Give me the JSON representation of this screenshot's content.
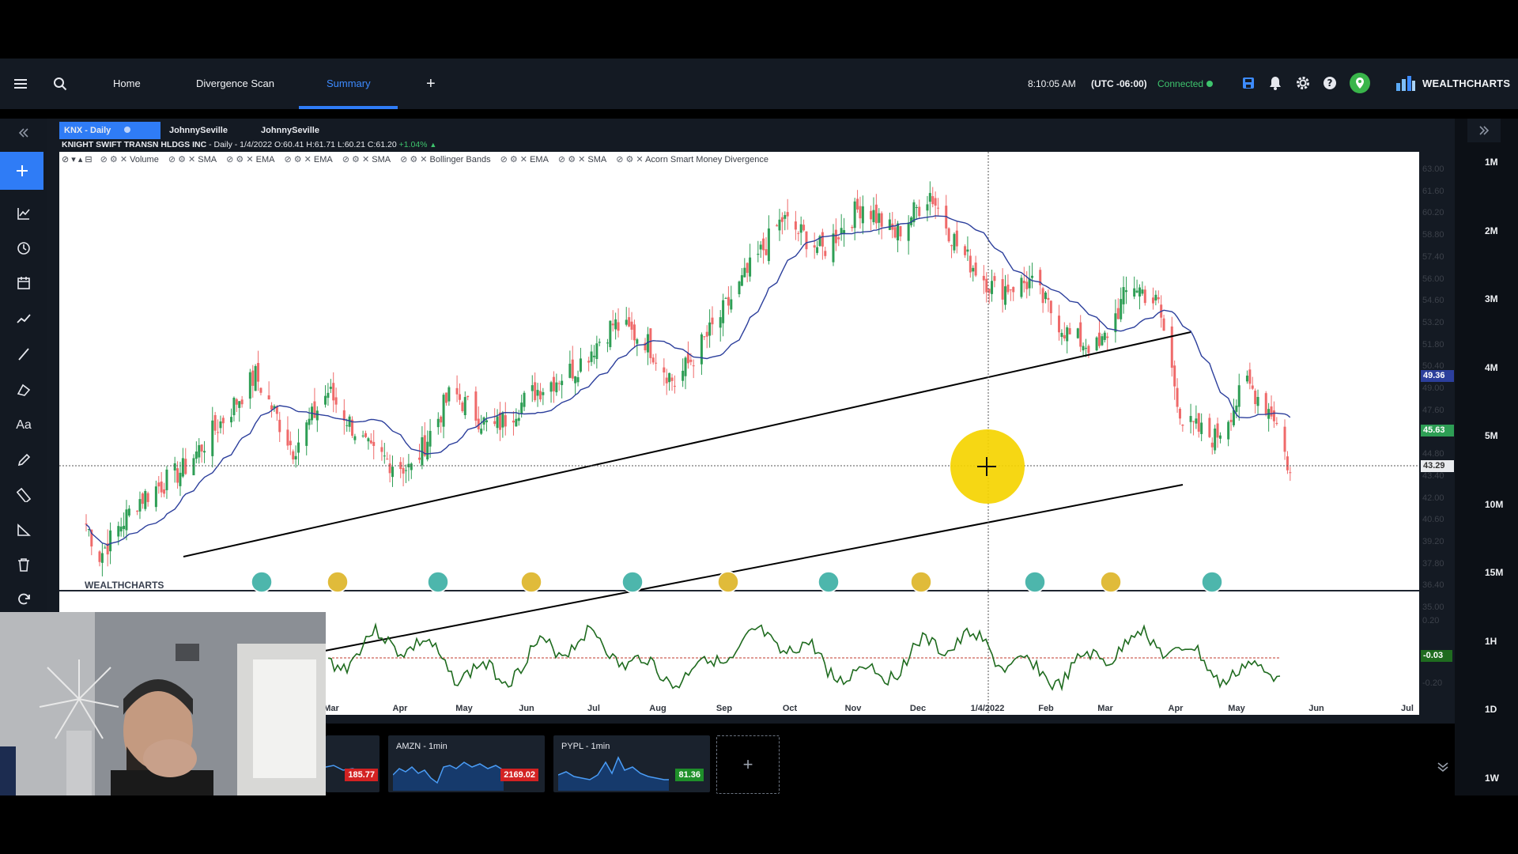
{
  "header": {
    "nav_tabs": [
      {
        "label": "Home"
      },
      {
        "label": "Divergence Scan"
      },
      {
        "label": "Summary",
        "active": true
      }
    ],
    "add_tab": "+",
    "time": "8:10:05 AM",
    "timezone": "(UTC -06:00)",
    "status": "Connected",
    "brand": "WEALTHCHARTS"
  },
  "chart": {
    "tabs": [
      {
        "label": "KNX - Daily",
        "active": true
      },
      {
        "label": "JohnnySeville"
      },
      {
        "label": "JohnnySeville"
      }
    ],
    "info": {
      "name": "KNIGHT SWIFT TRANSN HLDGS INC",
      "interval_date": "- Daily - 1/4/2022",
      "ohlc": "O:60.41 H:61.71 L:60.21 C:61.20",
      "change": "+1.04%",
      "arrow": "▲"
    },
    "indicators": [
      "Volume",
      "SMA",
      "EMA",
      "EMA",
      "SMA",
      "Bollinger Bands",
      "EMA",
      "SMA",
      "Acorn Smart Money Divergence"
    ],
    "watermark": "WEALTHCHARTS",
    "colors": {
      "up": "#2e9e55",
      "down": "#ef6a6a",
      "ma": "#2c3f9c",
      "osc": "#1f6b1f",
      "highlight": "#f5d400"
    }
  },
  "chart_data": {
    "type": "candlestick",
    "symbol": "KNX",
    "interval": "Daily",
    "price_axis": [
      "63.00",
      "61.60",
      "60.20",
      "58.80",
      "57.40",
      "56.00",
      "54.60",
      "53.20",
      "51.80",
      "50.40",
      "49.00",
      "47.60",
      "46.20",
      "44.80",
      "43.40",
      "42.00",
      "40.60",
      "39.20",
      "37.80",
      "36.40",
      "35.00"
    ],
    "ylim": [
      35.0,
      63.0
    ],
    "x_axis": [
      "Mar",
      "Apr",
      "May",
      "Jun",
      "Jul",
      "Aug",
      "Sep",
      "Oct",
      "Nov",
      "Dec",
      "1/4/2022",
      "Feb",
      "Mar",
      "Apr",
      "May",
      "Jun",
      "Jul"
    ],
    "price_badges": [
      {
        "value": "49.36",
        "color": "#2c3f9c"
      },
      {
        "value": "45.63",
        "color": "#2e9e55"
      },
      {
        "value": "43.29",
        "color": "#e9ebee"
      }
    ],
    "close_series": [
      {
        "date": "2021-02-24",
        "close": 40.0
      },
      {
        "date": "2021-03-01",
        "close": 38.0
      },
      {
        "date": "2021-03-15",
        "close": 41.5
      },
      {
        "date": "2021-04-01",
        "close": 43.5
      },
      {
        "date": "2021-04-15",
        "close": 46.5
      },
      {
        "date": "2021-04-28",
        "close": 49.5
      },
      {
        "date": "2021-05-12",
        "close": 44.8
      },
      {
        "date": "2021-05-25",
        "close": 48.5
      },
      {
        "date": "2021-06-10",
        "close": 44.5
      },
      {
        "date": "2021-06-25",
        "close": 43.5
      },
      {
        "date": "2021-07-10",
        "close": 48.5
      },
      {
        "date": "2021-07-25",
        "close": 46.0
      },
      {
        "date": "2021-08-10",
        "close": 48.5
      },
      {
        "date": "2021-08-25",
        "close": 50.0
      },
      {
        "date": "2021-09-08",
        "close": 52.8
      },
      {
        "date": "2021-09-20",
        "close": 51.8
      },
      {
        "date": "2021-10-01",
        "close": 49.0
      },
      {
        "date": "2021-10-15",
        "close": 52.5
      },
      {
        "date": "2021-10-28",
        "close": 56.0
      },
      {
        "date": "2021-11-10",
        "close": 59.5
      },
      {
        "date": "2021-11-25",
        "close": 57.5
      },
      {
        "date": "2021-12-10",
        "close": 60.5
      },
      {
        "date": "2021-12-22",
        "close": 58.5
      },
      {
        "date": "2022-01-04",
        "close": 61.2
      },
      {
        "date": "2022-01-15",
        "close": 57.5
      },
      {
        "date": "2022-01-28",
        "close": 55.0
      },
      {
        "date": "2022-02-10",
        "close": 55.5
      },
      {
        "date": "2022-02-25",
        "close": 52.0
      },
      {
        "date": "2022-03-08",
        "close": 51.2
      },
      {
        "date": "2022-03-20",
        "close": 55.5
      },
      {
        "date": "2022-03-30",
        "close": 54.0
      },
      {
        "date": "2022-04-08",
        "close": 46.5
      },
      {
        "date": "2022-04-20",
        "close": 45.5
      },
      {
        "date": "2022-05-02",
        "close": 49.0
      },
      {
        "date": "2022-05-12",
        "close": 47.0
      },
      {
        "date": "2022-05-18",
        "close": 43.29
      }
    ],
    "oscillator": {
      "axis": [
        "0.20",
        "-0.20"
      ],
      "value": "-0.03"
    }
  },
  "watchlist": [
    {
      "symbol": "",
      "value": "185.77",
      "badge_color": "#d32222"
    },
    {
      "symbol": "AMZN - 1min",
      "value": "2169.02",
      "badge_color": "#d32222"
    },
    {
      "symbol": "PYPL - 1min",
      "value": "81.36",
      "badge_color": "#1f8f2a"
    }
  ],
  "add_widget": "+",
  "timeframes": [
    "1M",
    "2M",
    "3M",
    "4M",
    "5M",
    "10M",
    "15M",
    "1H",
    "1D",
    "1W"
  ]
}
